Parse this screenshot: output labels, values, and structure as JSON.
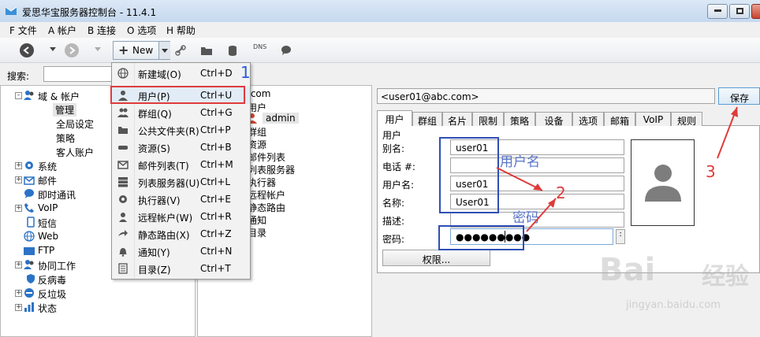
{
  "window": {
    "title": "爱思华宝服务器控制台 - 11.4.1"
  },
  "menubar": [
    "F 文件",
    "A 帐户",
    "B 连接",
    "O 选项",
    "H 帮助"
  ],
  "toolbar": {
    "new_label": "New",
    "dns_label": "DNS"
  },
  "search": {
    "label": "搜索:",
    "value": ""
  },
  "tree": [
    {
      "label": "域 & 帐户",
      "expander": "-"
    },
    {
      "label": "管理"
    },
    {
      "label": "全局设定"
    },
    {
      "label": "策略"
    },
    {
      "label": "客人账户"
    },
    {
      "label": "系统",
      "expander": "+"
    },
    {
      "label": "邮件",
      "expander": "+"
    },
    {
      "label": "即时通讯"
    },
    {
      "label": "VoIP",
      "expander": "+"
    },
    {
      "label": "短信"
    },
    {
      "label": "Web"
    },
    {
      "label": "FTP"
    },
    {
      "label": "协同工作",
      "expander": "+"
    },
    {
      "label": "反病毒"
    },
    {
      "label": "反垃圾",
      "expander": "+"
    },
    {
      "label": "状态",
      "expander": "+"
    }
  ],
  "middle": {
    "domain_suffix": ".com",
    "items": [
      "用户",
      "群组",
      "资源",
      "邮件列表",
      "列表服务器",
      "执行器",
      "远程帐户",
      "静态路由",
      "通知",
      "目录"
    ],
    "admin": "admin"
  },
  "new_menu": [
    {
      "label": "新建域(O)",
      "shortcut": "Ctrl+D",
      "icon": "globe-icon"
    },
    {
      "label": "用户(P)",
      "shortcut": "Ctrl+U",
      "icon": "user-icon"
    },
    {
      "label": "群组(Q)",
      "shortcut": "Ctrl+G",
      "icon": "group-icon"
    },
    {
      "label": "公共文件夹(R)",
      "shortcut": "Ctrl+P",
      "icon": "folder-icon"
    },
    {
      "label": "资源(S)",
      "shortcut": "Ctrl+B",
      "icon": "resource-icon"
    },
    {
      "label": "邮件列表(T)",
      "shortcut": "Ctrl+M",
      "icon": "envelope-icon"
    },
    {
      "label": "列表服务器(U)",
      "shortcut": "Ctrl+L",
      "icon": "server-icon"
    },
    {
      "label": "执行器(V)",
      "shortcut": "Ctrl+E",
      "icon": "gear-icon"
    },
    {
      "label": "远程帐户(W)",
      "shortcut": "Ctrl+R",
      "icon": "remote-icon"
    },
    {
      "label": "静态路由(X)",
      "shortcut": "Ctrl+Z",
      "icon": "route-icon"
    },
    {
      "label": "通知(Y)",
      "shortcut": "Ctrl+N",
      "icon": "bell-icon"
    },
    {
      "label": "目录(Z)",
      "shortcut": "Ctrl+T",
      "icon": "directory-icon"
    }
  ],
  "details": {
    "email": "<user01@abc.com>",
    "save_label": "保存",
    "tabs": [
      "用户",
      "群组",
      "名片",
      "限制",
      "策略",
      "设备",
      "选项",
      "邮箱",
      "VoIP",
      "规则"
    ],
    "section_title": "用户",
    "fields": [
      {
        "label": "别名:",
        "value": "user01"
      },
      {
        "label": "电话 #:",
        "value": ""
      },
      {
        "label": "用户名:",
        "value": "user01"
      },
      {
        "label": "名称:",
        "value": "User01"
      },
      {
        "label": "描述:",
        "value": ""
      }
    ],
    "password_label": "密码:",
    "password_value": "●●●●●●●●●",
    "password_btn": ":",
    "permissions_label": "权限..."
  },
  "annotations": {
    "n1": "1",
    "n2": "2",
    "n3": "3",
    "username_note": "用户名",
    "password_note": "密码"
  },
  "watermark": {
    "brand": "Bai",
    "brand2": "经验",
    "url": "jingyan.baidu.com"
  },
  "colors": {
    "annotation_red": "#e03b3b",
    "annotation_blue": "#2f4fb5",
    "accent_blue": "#2a5ad6"
  }
}
